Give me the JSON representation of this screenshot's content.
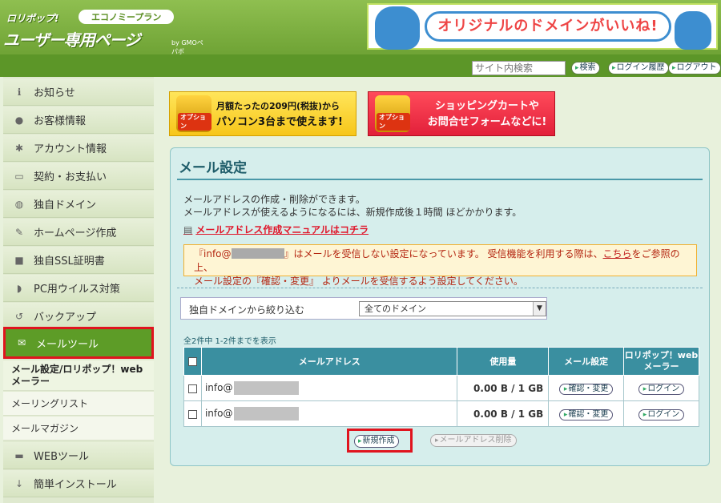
{
  "header": {
    "logo_top": "ロリポップ!",
    "plan": "エコノミープラン",
    "logo_main": "ユーザー専用ページ",
    "logo_by": "by GMOペパボ",
    "banner_text": "オリジナルのドメインがいいね!"
  },
  "subbar": {
    "search_placeholder": "サイト内検索",
    "search_button": "検索",
    "login_history": "ログイン履歴",
    "logout": "ログアウト"
  },
  "sidebar": {
    "items": [
      {
        "label": "お知らせ",
        "icon": "info-icon"
      },
      {
        "label": "お客様情報",
        "icon": "user-icon"
      },
      {
        "label": "アカウント情報",
        "icon": "gear-icon"
      },
      {
        "label": "契約・お支払い",
        "icon": "card-icon"
      },
      {
        "label": "独自ドメイン",
        "icon": "globe-icon"
      },
      {
        "label": "ホームページ作成",
        "icon": "edit-icon"
      },
      {
        "label": "独自SSL証明書",
        "icon": "lock-icon"
      },
      {
        "label": "PC用ウイルス対策",
        "icon": "shield-icon"
      },
      {
        "label": "バックアップ",
        "icon": "history-icon"
      },
      {
        "label": "メールツール",
        "icon": "mail-icon"
      },
      {
        "label": "WEBツール",
        "icon": "monitor-icon"
      },
      {
        "label": "簡単インストール",
        "icon": "download-icon"
      }
    ],
    "sub_items": [
      "メール設定/ロリポップ！webメーラー",
      "メーリングリスト",
      "メールマガジン"
    ]
  },
  "ads": {
    "ad1_line1": "月額たったの209円(税抜)から",
    "ad1_line2": "パソコン3台まで使えます!",
    "ad2_line1": "ショッピングカートや",
    "ad2_line2": "お問合せフォームなどに!",
    "option_label": "オプション"
  },
  "main": {
    "title": "メール設定",
    "desc1": "メールアドレスの作成・削除ができます。",
    "desc2": "メールアドレスが使えるようになるには、新規作成後１時間 ほどかかります。",
    "manual_link": "メールアドレス作成マニュアルはコチラ",
    "notice_a": "『info@",
    "notice_b": "』はメールを受信しない設定になっています。 受信機能を利用する際は、",
    "notice_link": "こちら",
    "notice_c": "をご参照の上、",
    "notice_d": "メール設定の『確認・変更』 よりメールを受信するよう設定してください。",
    "filter_label": "独自ドメインから絞り込む",
    "filter_value": "全てのドメイン",
    "count": "全2件中 1-2件までを表示",
    "table": {
      "headers": [
        "メールアドレス",
        "使用量",
        "メール設定",
        "ロリポップ！webメーラー"
      ],
      "rows": [
        {
          "address": "info@",
          "usage": "0.00 B / 1 GB",
          "settings": "確認・変更",
          "login": "ログイン"
        },
        {
          "address": "info@",
          "usage": "0.00 B / 1 GB",
          "settings": "確認・変更",
          "login": "ログイン"
        }
      ]
    },
    "new_button": "新規作成",
    "delete_button": "メールアドレス削除"
  }
}
